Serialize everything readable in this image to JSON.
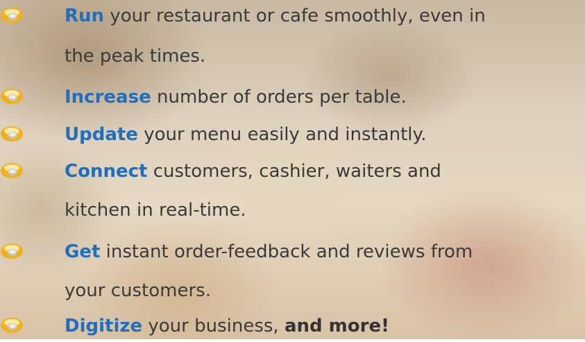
{
  "bullets": [
    {
      "keyword": "Run",
      "line1": " your restaurant or cafe smoothly, even in",
      "line2": "the peak times."
    },
    {
      "keyword": "Increase",
      "line1": " number of orders per table."
    },
    {
      "keyword": "Update",
      "line1": " your menu easily and instantly."
    },
    {
      "keyword": "Connect",
      "line1": " customers, cashier, waiters and",
      "line2": "kitchen in real-time."
    },
    {
      "keyword": "Get",
      "line1": " instant order-feedback and reviews from",
      "line2": "your customers."
    },
    {
      "keyword": "Digitize",
      "line1": " your business, ",
      "emphasis": "and more!"
    }
  ],
  "colors": {
    "keyword": "#1f6fbf",
    "bullet": "#f0b21c",
    "text": "#3a3a3a"
  },
  "icon": "coffee-cup-bullet-icon"
}
